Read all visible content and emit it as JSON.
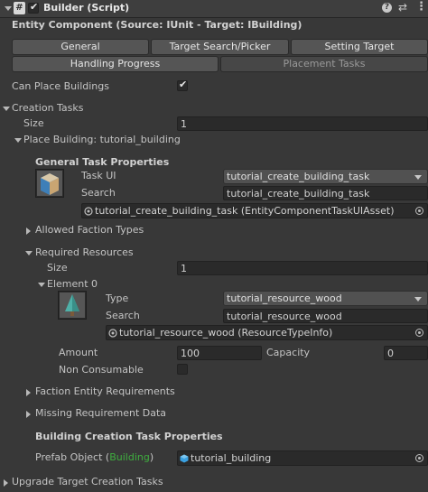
{
  "header": {
    "title": "Builder (Script)",
    "enabled": true
  },
  "subtitle": "Entity Component (Source: IUnit - Target: IBuilding)",
  "tabs_row1": [
    {
      "label": "General",
      "active": false
    },
    {
      "label": "Target Search/Picker",
      "active": false
    },
    {
      "label": "Setting Target",
      "active": false
    }
  ],
  "tabs_row2": [
    {
      "label": "Handling Progress",
      "active": false
    },
    {
      "label": "Placement Tasks",
      "active": true
    }
  ],
  "can_place_buildings": {
    "label": "Can Place Buildings",
    "checked": true
  },
  "creation_tasks": {
    "label": "Creation Tasks",
    "size_label": "Size",
    "size_value": "1",
    "element_label": "Place Building: tutorial_building",
    "general_props_label": "General Task Properties",
    "task_ui_label": "Task UI",
    "task_ui_value": "tutorial_create_building_task",
    "search_label": "Search",
    "search_value": "tutorial_create_building_task",
    "asset_ref": "tutorial_create_building_task (EntityComponentTaskUIAsset)",
    "allowed_faction_label": "Allowed Faction Types",
    "required_resources_label": "Required Resources",
    "rr_size_label": "Size",
    "rr_size_value": "1",
    "element0_label": "Element 0",
    "type_label": "Type",
    "type_value": "tutorial_resource_wood",
    "res_search_label": "Search",
    "res_search_value": "tutorial_resource_wood",
    "res_asset_ref": "tutorial_resource_wood (ResourceTypeInfo)",
    "amount_label": "Amount",
    "amount_value": "100",
    "capacity_label": "Capacity",
    "capacity_value": "0",
    "non_consumable_label": "Non Consumable",
    "faction_entity_req_label": "Faction Entity Requirements",
    "missing_req_label": "Missing Requirement Data",
    "building_creation_label": "Building Creation Task Properties",
    "prefab_label_prefix": "Prefab Object (",
    "prefab_label_link": "Building",
    "prefab_label_suffix": ")",
    "prefab_value": "tutorial_building"
  },
  "upgrade_label": "Upgrade Target Creation Tasks",
  "colors": {
    "background": "#383838",
    "link_green": "#3fae3f",
    "prefab_icon": "#3aa0e0"
  },
  "icons": [
    "script-icon",
    "help-icon",
    "settings-icon",
    "more-icon",
    "checkmark-icon",
    "object-picker-icon"
  ]
}
